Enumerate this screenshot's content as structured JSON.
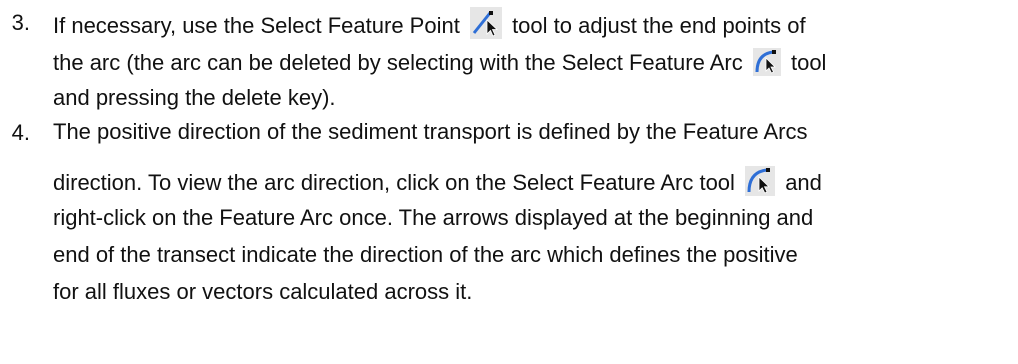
{
  "list": {
    "item3": {
      "number": "3.",
      "line1_a": "If necessary, use the Select Feature Point",
      "line1_b": "tool to adjust the end points of",
      "line2_a": "the arc (the arc can be deleted by selecting with the Select Feature Arc",
      "line2_b": "tool",
      "line3": "and pressing the delete key)."
    },
    "item4": {
      "number": "4.",
      "line1": "The positive direction of the sediment transport is defined by the Feature Arcs",
      "line2_a": "direction. To view the arc direction, click on the Select Feature Arc tool",
      "line2_b": "and",
      "line3": "right-click on the Feature Arc once. The arrows displayed at the beginning and",
      "line4": "end of the transect indicate the direction of the arc which defines the positive",
      "line5": "for all fluxes or vectors calculated across it."
    }
  },
  "icons": {
    "select_feature_point": "select-feature-point-icon",
    "select_feature_arc": "select-feature-arc-icon"
  },
  "colors": {
    "text": "#111111",
    "icon_bg": "#e6e6e6",
    "icon_arc": "#2f6fd6",
    "icon_cursor": "#111111"
  }
}
